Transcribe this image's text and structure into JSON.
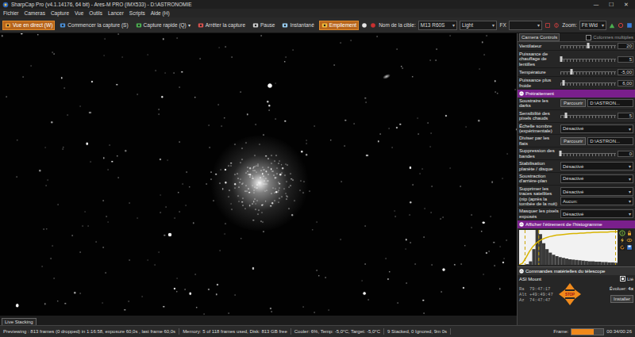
{
  "window": {
    "title": "SharpCap Pro (v4.1.14176, 64 bit) - Ares-M PRO (IMX533) - D:\\ASTRONOMIE",
    "controls": [
      "—",
      "☐",
      "✕"
    ]
  },
  "menu": [
    "Fichier",
    "Cameras",
    "Capture",
    "Vue",
    "Outils",
    "Lancer",
    "Scripts",
    "Aide (H)"
  ],
  "toolbar": {
    "buttons": [
      {
        "label": "Vue en direct (W)",
        "selected": true
      },
      {
        "label": "Commencer la capture (S)",
        "selected": false
      },
      {
        "label": "Capture rapide (Q)",
        "selected": false
      },
      {
        "label": "Arrêter la capture",
        "selected": false
      },
      {
        "label": "Pause",
        "selected": false
      },
      {
        "label": "Instantané",
        "selected": false
      },
      {
        "label": "Empilement",
        "selected": true
      }
    ],
    "dropdown_arrow": "▾",
    "target_label": "Nom de la cible:",
    "target": "M13 R60S",
    "frame_type": "Light",
    "fx_label": "FX",
    "fx": "",
    "zoom_label": "Zoom:",
    "zoom": "Fit Wid"
  },
  "viewer": {
    "tab": "Live Stacking"
  },
  "panel": {
    "tab": "Camera Controls",
    "multi_columns": {
      "label": "Colonnes multiples",
      "checked": false
    },
    "camera_controls": [
      {
        "kind": "slider",
        "label": "Ventilateur",
        "value": "20",
        "level": 0.5
      },
      {
        "kind": "slider",
        "label": "Puissance de chauffage de lentilles",
        "value": "5",
        "level": 0.02
      },
      {
        "kind": "slider",
        "label": "Température",
        "value": "-5,00",
        "level": 0.2
      },
      {
        "kind": "slider",
        "label": "Puissance plus froide",
        "value": "6,00",
        "level": 0.05
      }
    ],
    "preprocessing": {
      "title": "Prétraitement",
      "expanded": true,
      "rows": [
        {
          "kind": "file",
          "label": "Soustraire les darks",
          "button": "Parcourir",
          "value": "D:\\ASTRON..."
        },
        {
          "kind": "slider",
          "label": "Sensibilité des pixels chauds",
          "value": "5",
          "level": 0.1
        },
        {
          "kind": "select",
          "label": "Échelle sombre (expérimentale)",
          "values": [
            "Désactivé"
          ]
        },
        {
          "kind": "file",
          "label": "Diviser par les flats",
          "button": "Parcourir",
          "value": "D:\\ASTRON..."
        },
        {
          "kind": "slider",
          "label": "Suppression des bandes",
          "value": "0",
          "level": 0
        },
        {
          "kind": "select",
          "label": "Stabilisation planète / disque",
          "values": [
            "Désactivé"
          ]
        },
        {
          "kind": "select",
          "label": "Soustraction d'arrière-plan",
          "values": [
            "Désactivé"
          ]
        },
        {
          "kind": "select",
          "label": "Supprimer les traces satellites (nip (après la tombée de la nuit)",
          "values": [
            "Désactivé",
            "Aucun:"
          ]
        },
        {
          "kind": "select",
          "label": "Masquer les pixels exposés",
          "values": [
            "Désactivé"
          ]
        }
      ]
    },
    "histogram": {
      "title": "Afficher l'étirement de l'histogramme",
      "expanded": true,
      "counts": [
        0,
        0,
        2,
        10,
        45,
        100,
        88,
        62,
        45,
        35,
        29,
        25,
        22,
        20,
        18,
        16,
        15,
        14,
        13,
        12,
        11,
        10,
        10,
        9,
        9,
        8,
        8,
        7,
        7,
        6
      ],
      "stretch": [
        0,
        5,
        20,
        38,
        52,
        62,
        69,
        74,
        78,
        81,
        83,
        85,
        86,
        87,
        88,
        89,
        90,
        90,
        91,
        91,
        92,
        92,
        93,
        93,
        94,
        94,
        94,
        95,
        95,
        95
      ],
      "markers": [
        {
          "level": 0.06
        },
        {
          "level": 0.2
        },
        {
          "level": 0.98
        }
      ]
    },
    "telescope": {
      "title": "Commandes matérielles du télescope",
      "expanded": true,
      "mount": "ASI Mount",
      "linked": {
        "label": "Lié",
        "checked": true
      },
      "speed_label": "Évoluer:",
      "speed": "4x",
      "coordinates": [
        {
          "label": "Ra",
          "value": "79:47:17"
        },
        {
          "label": "Alt",
          "value": "+49:49:47"
        },
        {
          "label": "Az",
          "value": "74:47:47"
        }
      ],
      "pad_label": "STOP",
      "button": "Installer"
    }
  },
  "status_bar": {
    "items": [
      "Previewing : 813 frames (0 dropped) in 1:16:58, exposure 60,0s , last frame 60,0s",
      "Memory: 5 of 118 frames used, Disk: 813 GB free",
      "Cooler: 6%, Temp: -5,0°C, Target: -5,0°C",
      "9 Stacked, 0 Ignored, 9m 0s"
    ],
    "frame": {
      "label": "Frame:",
      "level": 0.7,
      "time": "00:34/00:26"
    }
  }
}
